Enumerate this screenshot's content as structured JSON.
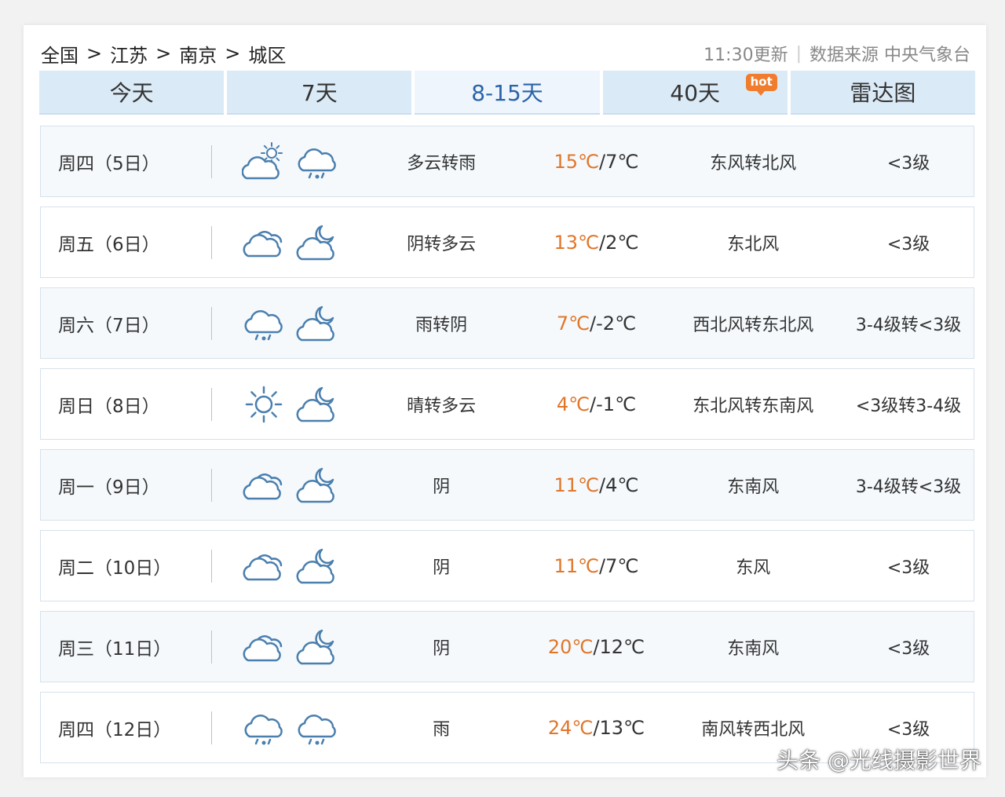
{
  "breadcrumb": {
    "items": [
      "全国",
      "江苏",
      "南京",
      "城区"
    ],
    "separator": ">"
  },
  "meta": {
    "update_time": "11:30更新",
    "source": "数据来源 中央气象台"
  },
  "tabs": [
    {
      "label": "今天",
      "active": false
    },
    {
      "label": "7天",
      "active": false
    },
    {
      "label": "8-15天",
      "active": true
    },
    {
      "label": "40天",
      "active": false,
      "badge": "hot"
    },
    {
      "label": "雷达图",
      "active": false
    }
  ],
  "forecast": [
    {
      "day": "周四（5日）",
      "icon_day": "partly-cloudy-sun-icon",
      "icon_night": "rain-cloud-icon",
      "desc": "多云转雨",
      "high": "15℃",
      "low": "/7℃",
      "wind": "东风转北风",
      "level": "<3级"
    },
    {
      "day": "周五（6日）",
      "icon_day": "cloudy-icon",
      "icon_night": "cloud-moon-icon",
      "desc": "阴转多云",
      "high": "13℃",
      "low": "/2℃",
      "wind": "东北风",
      "level": "<3级"
    },
    {
      "day": "周六（7日）",
      "icon_day": "rain-cloud-icon",
      "icon_night": "cloud-moon-icon",
      "desc": "雨转阴",
      "high": "7℃",
      "low": "/-2℃",
      "wind": "西北风转东北风",
      "level": "3-4级转<3级"
    },
    {
      "day": "周日（8日）",
      "icon_day": "sun-icon",
      "icon_night": "cloud-moon-icon",
      "desc": "晴转多云",
      "high": "4℃",
      "low": "/-1℃",
      "wind": "东北风转东南风",
      "level": "<3级转3-4级"
    },
    {
      "day": "周一（9日）",
      "icon_day": "cloudy-icon",
      "icon_night": "cloud-moon-icon",
      "desc": "阴",
      "high": "11℃",
      "low": "/4℃",
      "wind": "东南风",
      "level": "3-4级转<3级"
    },
    {
      "day": "周二（10日）",
      "icon_day": "cloudy-icon",
      "icon_night": "cloud-moon-icon",
      "desc": "阴",
      "high": "11℃",
      "low": "/7℃",
      "wind": "东风",
      "level": "<3级"
    },
    {
      "day": "周三（11日）",
      "icon_day": "cloudy-icon",
      "icon_night": "cloud-moon-icon",
      "desc": "阴",
      "high": "20℃",
      "low": "/12℃",
      "wind": "东南风",
      "level": "<3级"
    },
    {
      "day": "周四（12日）",
      "icon_day": "rain-cloud-icon",
      "icon_night": "rain-cloud-icon",
      "desc": "雨",
      "high": "24℃",
      "low": "/13℃",
      "wind": "南风转西北风",
      "level": "<3级"
    }
  ],
  "watermark": "头条 @光线摄影世界",
  "colors": {
    "tab_bg": "#dbeaf7",
    "tab_active_text": "#2a63a8",
    "high_temp": "#e0762a",
    "icon_stroke": "#4a7fae",
    "hot_badge": "#f07d2e"
  }
}
